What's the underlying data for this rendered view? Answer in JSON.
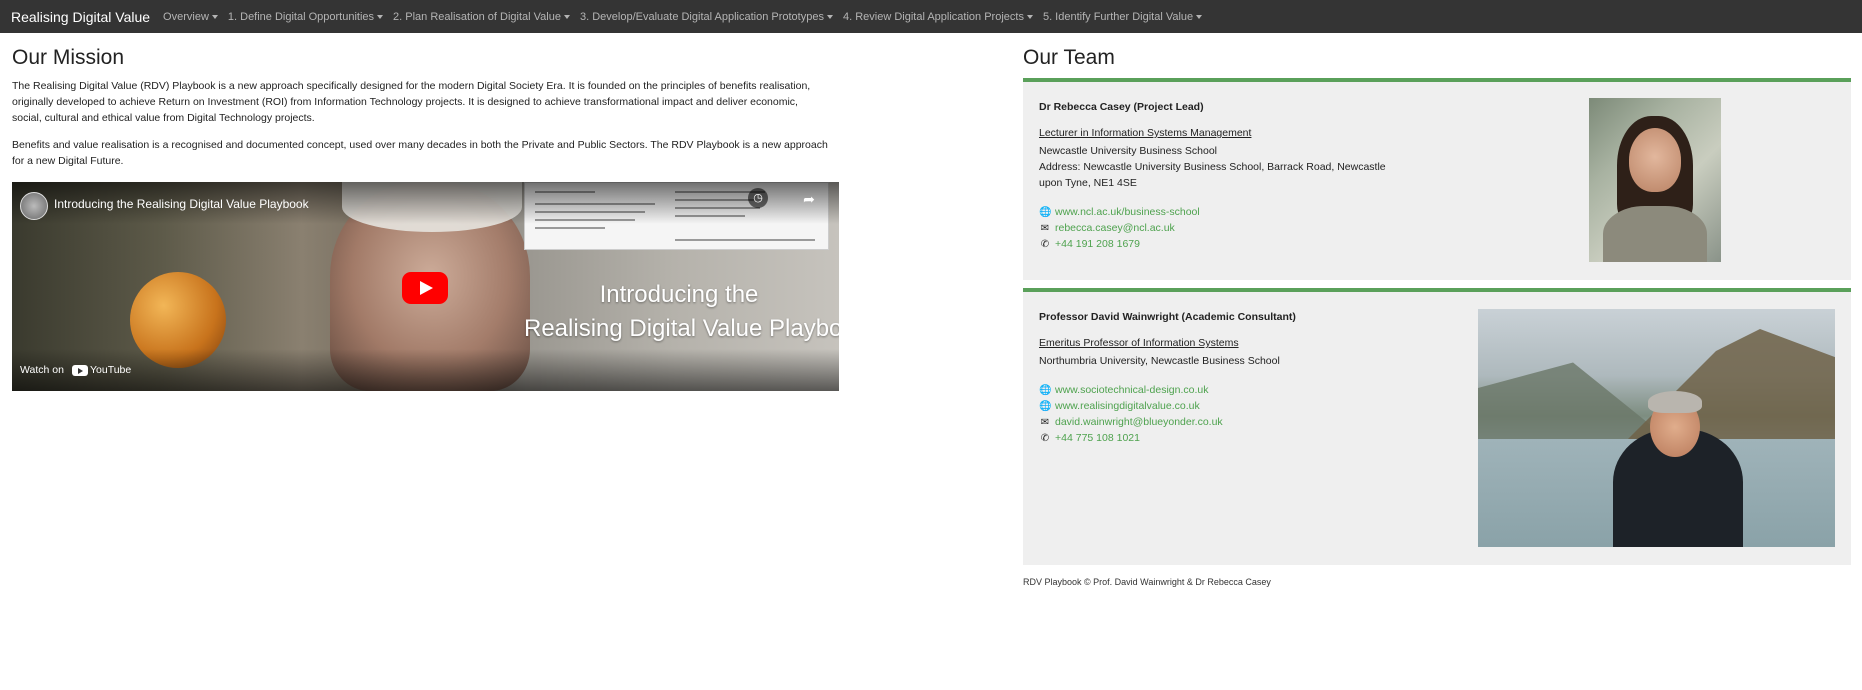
{
  "navbar": {
    "brand": "Realising Digital Value",
    "items": [
      {
        "label": "Overview"
      },
      {
        "label": "1. Define Digital Opportunities"
      },
      {
        "label": "2. Plan Realisation of Digital Value"
      },
      {
        "label": "3. Develop/Evaluate Digital Application Prototypes"
      },
      {
        "label": "4. Review Digital Application Projects"
      },
      {
        "label": "5. Identify Further Digital Value"
      }
    ]
  },
  "mission": {
    "title": "Our Mission",
    "paragraph1": "The Realising Digital Value (RDV) Playbook is a new approach specifically designed for the modern Digital Society Era. It is founded on the principles of benefits realisation, originally developed to achieve Return on Investment (ROI) from Information Technology projects. It is designed to achieve transformational impact and deliver economic, social, cultural and ethical value from Digital Technology projects.",
    "paragraph2": "Benefits and value realisation is a recognised and documented concept, used over many decades in both the Private and Public Sectors. The RDV Playbook is a new approach for a new Digital Future."
  },
  "video": {
    "title": "Introducing the Realising Digital Value Playbook",
    "overlay_line1": "Introducing the",
    "overlay_line2": "Realising Digital Value Playbook",
    "watch_on": "Watch on",
    "youtube": "YouTube"
  },
  "team": {
    "title": "Our Team",
    "members": [
      {
        "name": "Dr Rebecca Casey (Project Lead)",
        "role": "Lecturer in Information Systems Management",
        "org": "Newcastle University Business School",
        "address": "Address: Newcastle University Business School, Barrack Road, Newcastle upon Tyne, NE1 4SE",
        "links": [
          {
            "icon": "globe-icon",
            "text": "www.ncl.ac.uk/business-school"
          },
          {
            "icon": "envelope-icon",
            "text": "rebecca.casey@ncl.ac.uk"
          },
          {
            "icon": "phone-icon",
            "text": "+44 191 208 1679"
          }
        ]
      },
      {
        "name": "Professor David Wainwright (Academic Consultant)",
        "role": "Emeritus Professor of Information Systems",
        "org": "Northumbria University, Newcastle Business School",
        "links": [
          {
            "icon": "globe-icon",
            "text": "www.sociotechnical-design.co.uk"
          },
          {
            "icon": "globe-icon",
            "text": "www.realisingdigitalvalue.co.uk"
          },
          {
            "icon": "envelope-icon",
            "text": "david.wainwright@blueyonder.co.uk"
          },
          {
            "icon": "phone-icon",
            "text": "+44 775 108 1021"
          }
        ]
      }
    ]
  },
  "footer": {
    "text": "RDV Playbook © Prof. David Wainwright & Dr Rebecca Casey"
  },
  "colors": {
    "navbar_bg": "#343434",
    "accent_green": "#5aa05a",
    "link_green": "#4ea24e",
    "card_bg": "#efefef"
  }
}
